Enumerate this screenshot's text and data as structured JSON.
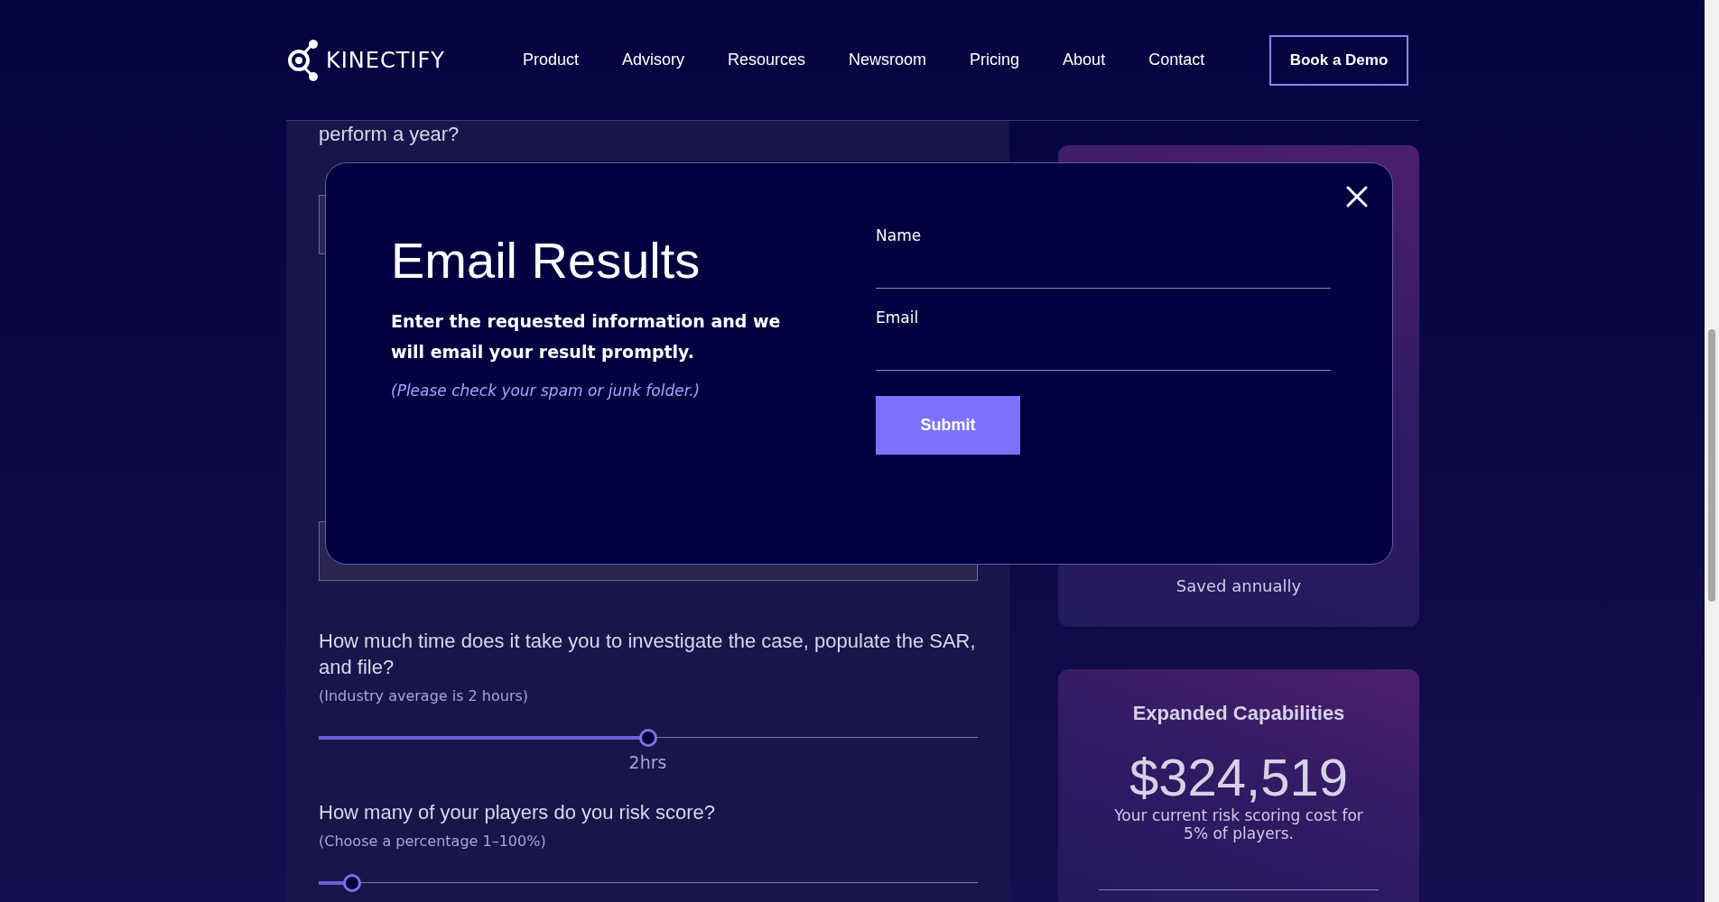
{
  "header": {
    "logo": "KINECTIFY",
    "nav": [
      {
        "label": "Product"
      },
      {
        "label": "Advisory"
      },
      {
        "label": "Resources"
      },
      {
        "label": "Newsroom"
      },
      {
        "label": "Pricing"
      },
      {
        "label": "About"
      },
      {
        "label": "Contact"
      }
    ],
    "cta": "Book a Demo"
  },
  "calculator": {
    "partial_question": "perform a year?",
    "questions": [
      {
        "question": "How much time does it take you to investigate the case, populate the SAR, and file?",
        "hint": "(Industry average is 2 hours)",
        "level": 0.5,
        "reading": "2hrs"
      },
      {
        "question": "How many of your players do you risk score?",
        "hint": "(Choose a percentage 1–100%)",
        "level": 0.05
      }
    ]
  },
  "results": [
    {
      "caption": "Saved annually"
    },
    {
      "title": "Expanded Capabilities",
      "amount": "$324,519",
      "description": "Your current risk scoring cost for 5% of players."
    }
  ],
  "modal": {
    "title": "Email Results",
    "text": "Enter the requested information and we will email your result promptly.",
    "note": "(Please check your spam or junk folder.)",
    "fields": [
      {
        "label": "Name"
      },
      {
        "label": "Email"
      }
    ],
    "submit": "Submit"
  }
}
